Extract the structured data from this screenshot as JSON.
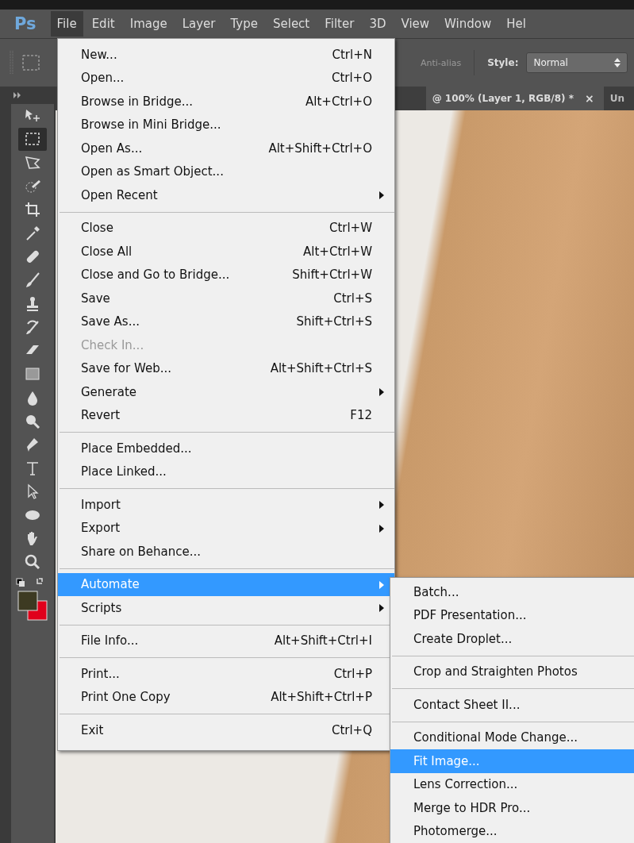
{
  "app": {
    "logo": "Ps"
  },
  "menubar": [
    {
      "label": "File",
      "selected": true
    },
    {
      "label": "Edit",
      "selected": false
    },
    {
      "label": "Image",
      "selected": false
    },
    {
      "label": "Layer",
      "selected": false
    },
    {
      "label": "Type",
      "selected": false
    },
    {
      "label": "Select",
      "selected": false
    },
    {
      "label": "Filter",
      "selected": false
    },
    {
      "label": "3D",
      "selected": false
    },
    {
      "label": "View",
      "selected": false
    },
    {
      "label": "Window",
      "selected": false
    },
    {
      "label": "Hel",
      "selected": false
    }
  ],
  "options_bar": {
    "anti_alias": {
      "label": "Anti-alias",
      "disabled": true
    },
    "style_label": "Style:",
    "style_value": "Normal"
  },
  "document_tabs": [
    {
      "label": "@ 100% (Layer 1, RGB/8) *",
      "close": "×",
      "selected": true
    },
    {
      "label": "Un",
      "selected": false
    }
  ],
  "tools": [
    {
      "kind": "move",
      "selected": false
    },
    {
      "kind": "marquee",
      "selected": true
    },
    {
      "kind": "lasso",
      "selected": false
    },
    {
      "kind": "quick-select",
      "selected": false
    },
    {
      "kind": "crop",
      "selected": false
    },
    {
      "kind": "eyedropper",
      "selected": false
    },
    {
      "kind": "healing",
      "selected": false
    },
    {
      "kind": "brush",
      "selected": false
    },
    {
      "kind": "stamp",
      "selected": false
    },
    {
      "kind": "history-brush",
      "selected": false
    },
    {
      "kind": "eraser",
      "selected": false
    },
    {
      "kind": "gradient",
      "selected": false
    },
    {
      "kind": "blur",
      "selected": false
    },
    {
      "kind": "dodge",
      "selected": false
    },
    {
      "kind": "pen",
      "selected": false
    },
    {
      "kind": "type",
      "selected": false
    },
    {
      "kind": "path-select",
      "selected": false
    },
    {
      "kind": "ellipse",
      "selected": false
    },
    {
      "kind": "hand",
      "selected": false
    },
    {
      "kind": "zoom",
      "selected": false
    }
  ],
  "file_menu": [
    {
      "kind": "item",
      "label": "New...",
      "shortcut": "Ctrl+N",
      "submenu": false,
      "disabled": false,
      "selected": false
    },
    {
      "kind": "item",
      "label": "Open...",
      "shortcut": "Ctrl+O",
      "submenu": false,
      "disabled": false,
      "selected": false
    },
    {
      "kind": "item",
      "label": "Browse in Bridge...",
      "shortcut": "Alt+Ctrl+O",
      "submenu": false,
      "disabled": false,
      "selected": false
    },
    {
      "kind": "item",
      "label": "Browse in Mini Bridge...",
      "submenu": false,
      "disabled": false,
      "selected": false
    },
    {
      "kind": "item",
      "label": "Open As...",
      "shortcut": "Alt+Shift+Ctrl+O",
      "submenu": false,
      "disabled": false,
      "selected": false
    },
    {
      "kind": "item",
      "label": "Open as Smart Object...",
      "submenu": false,
      "disabled": false,
      "selected": false
    },
    {
      "kind": "item",
      "label": "Open Recent",
      "submenu": true,
      "disabled": false,
      "selected": false
    },
    {
      "kind": "separator"
    },
    {
      "kind": "item",
      "label": "Close",
      "shortcut": "Ctrl+W",
      "submenu": false,
      "disabled": false,
      "selected": false
    },
    {
      "kind": "item",
      "label": "Close All",
      "shortcut": "Alt+Ctrl+W",
      "submenu": false,
      "disabled": false,
      "selected": false
    },
    {
      "kind": "item",
      "label": "Close and Go to Bridge...",
      "shortcut": "Shift+Ctrl+W",
      "submenu": false,
      "disabled": false,
      "selected": false
    },
    {
      "kind": "item",
      "label": "Save",
      "shortcut": "Ctrl+S",
      "submenu": false,
      "disabled": false,
      "selected": false
    },
    {
      "kind": "item",
      "label": "Save As...",
      "shortcut": "Shift+Ctrl+S",
      "submenu": false,
      "disabled": false,
      "selected": false
    },
    {
      "kind": "item",
      "label": "Check In...",
      "submenu": false,
      "disabled": true,
      "selected": false
    },
    {
      "kind": "item",
      "label": "Save for Web...",
      "shortcut": "Alt+Shift+Ctrl+S",
      "submenu": false,
      "disabled": false,
      "selected": false
    },
    {
      "kind": "item",
      "label": "Generate",
      "submenu": true,
      "disabled": false,
      "selected": false
    },
    {
      "kind": "item",
      "label": "Revert",
      "shortcut": "F12",
      "submenu": false,
      "disabled": false,
      "selected": false
    },
    {
      "kind": "separator"
    },
    {
      "kind": "item",
      "label": "Place Embedded...",
      "submenu": false,
      "disabled": false,
      "selected": false
    },
    {
      "kind": "item",
      "label": "Place Linked...",
      "submenu": false,
      "disabled": false,
      "selected": false
    },
    {
      "kind": "separator"
    },
    {
      "kind": "item",
      "label": "Import",
      "submenu": true,
      "disabled": false,
      "selected": false
    },
    {
      "kind": "item",
      "label": "Export",
      "submenu": true,
      "disabled": false,
      "selected": false
    },
    {
      "kind": "item",
      "label": "Share on Behance...",
      "submenu": false,
      "disabled": false,
      "selected": false
    },
    {
      "kind": "separator"
    },
    {
      "kind": "item",
      "label": "Automate",
      "submenu": true,
      "disabled": false,
      "selected": true
    },
    {
      "kind": "item",
      "label": "Scripts",
      "submenu": true,
      "disabled": false,
      "selected": false
    },
    {
      "kind": "separator"
    },
    {
      "kind": "item",
      "label": "File Info...",
      "shortcut": "Alt+Shift+Ctrl+I",
      "submenu": false,
      "disabled": false,
      "selected": false
    },
    {
      "kind": "separator"
    },
    {
      "kind": "item",
      "label": "Print...",
      "shortcut": "Ctrl+P",
      "submenu": false,
      "disabled": false,
      "selected": false
    },
    {
      "kind": "item",
      "label": "Print One Copy",
      "shortcut": "Alt+Shift+Ctrl+P",
      "submenu": false,
      "disabled": false,
      "selected": false
    },
    {
      "kind": "separator"
    },
    {
      "kind": "item",
      "label": "Exit",
      "shortcut": "Ctrl+Q",
      "submenu": false,
      "disabled": false,
      "selected": false
    }
  ],
  "automate_menu": [
    {
      "kind": "item",
      "label": "Batch...",
      "selected": false
    },
    {
      "kind": "item",
      "label": "PDF Presentation...",
      "selected": false
    },
    {
      "kind": "item",
      "label": "Create Droplet...",
      "selected": false
    },
    {
      "kind": "separator"
    },
    {
      "kind": "item",
      "label": "Crop and Straighten Photos",
      "selected": false
    },
    {
      "kind": "separator"
    },
    {
      "kind": "item",
      "label": "Contact Sheet II...",
      "selected": false
    },
    {
      "kind": "separator"
    },
    {
      "kind": "item",
      "label": "Conditional Mode Change...",
      "selected": false
    },
    {
      "kind": "item",
      "label": "Fit Image...",
      "selected": true
    },
    {
      "kind": "item",
      "label": "Lens Correction...",
      "selected": false
    },
    {
      "kind": "item",
      "label": "Merge to HDR Pro...",
      "selected": false
    },
    {
      "kind": "item",
      "label": "Photomerge...",
      "selected": false
    }
  ]
}
